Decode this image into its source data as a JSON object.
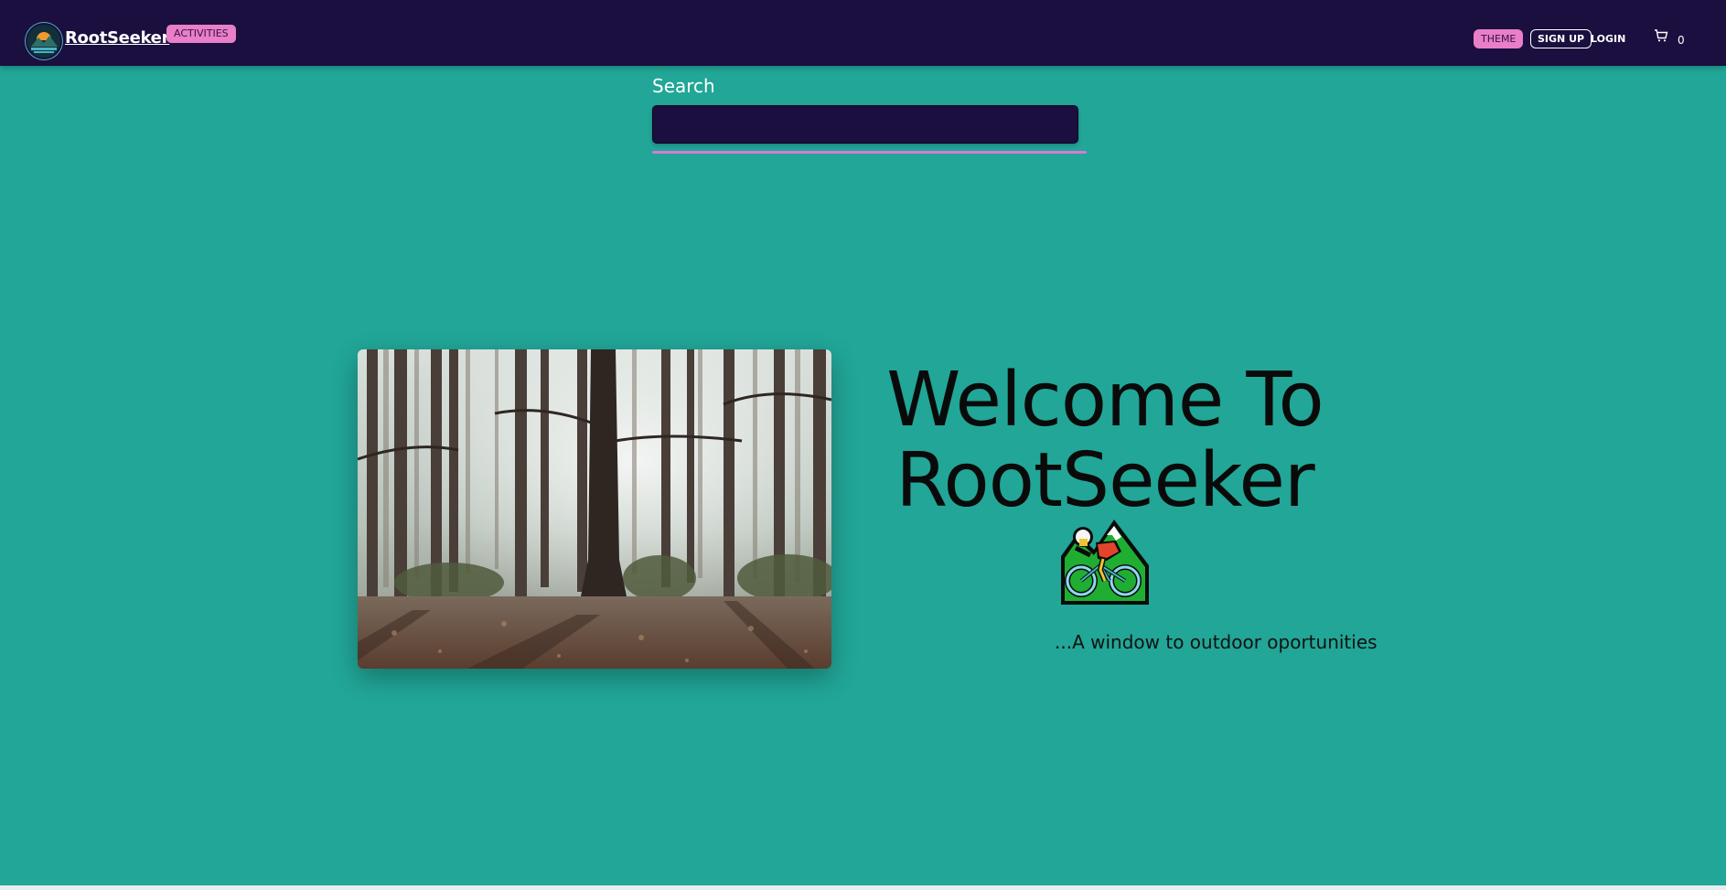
{
  "navbar": {
    "brand": "RootSeeker",
    "activities_label": "ACTIVITIES",
    "theme_label": "THEME",
    "signup_label": "SIGN UP",
    "login_label": "LOGIN",
    "cart_count": "0",
    "cart_icon": "cart-icon",
    "logo_icon": "mountain-sunset-logo"
  },
  "search": {
    "label": "Search",
    "value": "",
    "placeholder": ""
  },
  "hero": {
    "title": "Welcome To RootSeeker",
    "emoji": "mountain-biker-icon",
    "tagline": "...A window to outdoor oportunities",
    "image": "forest-sunlight-photo"
  },
  "colors": {
    "navbar_bg": "#1b0f3f",
    "page_bg": "#21a697",
    "accent_pink": "#e87fc8",
    "search_bg": "#1b0f3f"
  }
}
